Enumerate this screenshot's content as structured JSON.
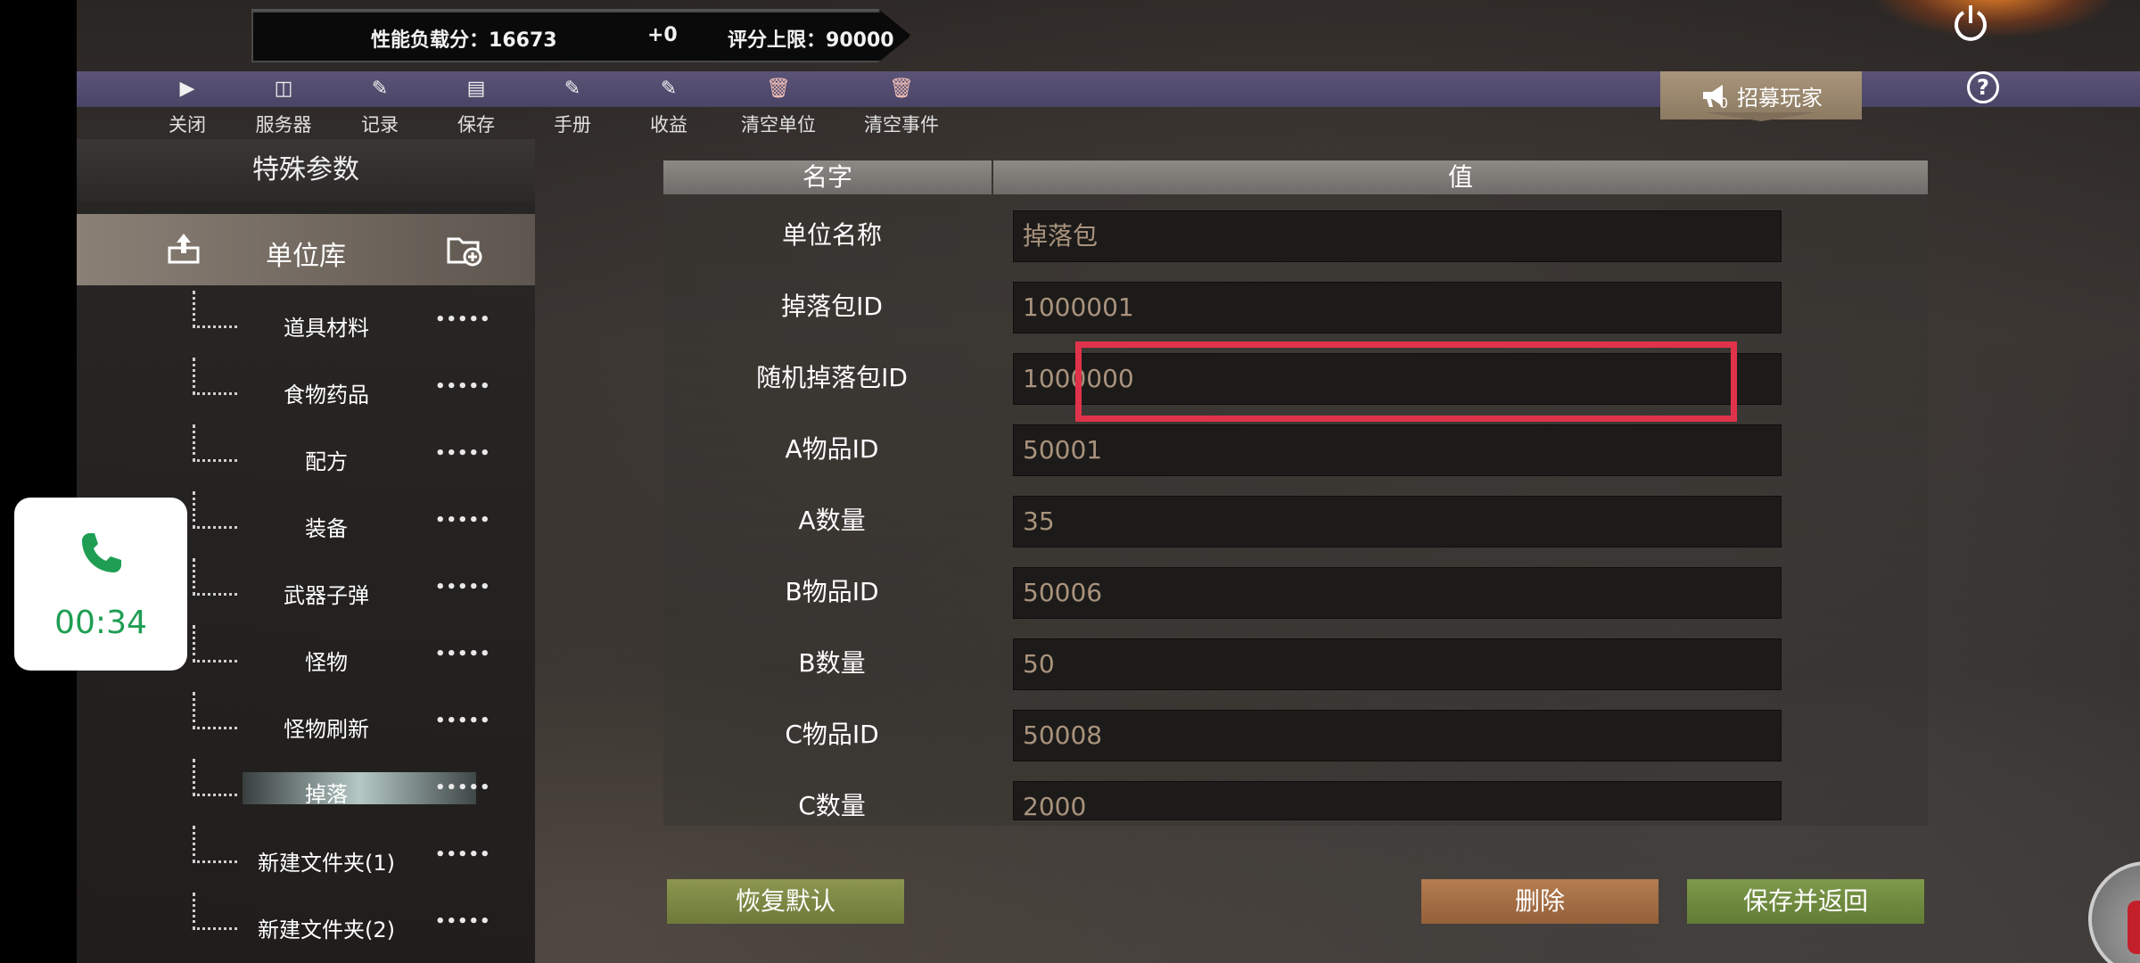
{
  "score": {
    "load_label": "性能负载分：",
    "load_value": "16673",
    "delta": "+0",
    "limit_label": "评分上限：",
    "limit_value": "90000"
  },
  "toolbar": [
    {
      "label": "关闭",
      "icon": "play-icon"
    },
    {
      "label": "服务器",
      "icon": "cube-icon"
    },
    {
      "label": "记录",
      "icon": "edit-icon"
    },
    {
      "label": "保存",
      "icon": "document-icon"
    },
    {
      "label": "手册",
      "icon": "edit-icon"
    },
    {
      "label": "收益",
      "icon": "edit-icon"
    },
    {
      "label": "清空单位",
      "icon": "trash-icon"
    },
    {
      "label": "清空事件",
      "icon": "trash-icon"
    }
  ],
  "recruit": {
    "label": "招募玩家",
    "count": "0"
  },
  "help": "?",
  "sidebar": {
    "title": "特殊参数",
    "library": "单位库",
    "items": [
      {
        "label": "道具材料"
      },
      {
        "label": "食物药品"
      },
      {
        "label": "配方"
      },
      {
        "label": "装备"
      },
      {
        "label": "武器子弹"
      },
      {
        "label": "怪物"
      },
      {
        "label": "怪物刷新"
      },
      {
        "label": "掉落",
        "active": true
      },
      {
        "label": "新建文件夹(1)"
      },
      {
        "label": "新建文件夹(2)"
      }
    ],
    "dots": "•••••"
  },
  "table": {
    "headers": {
      "name": "名字",
      "value": "值"
    },
    "rows": [
      {
        "name": "单位名称",
        "value": "掉落包"
      },
      {
        "name": "掉落包ID",
        "value": "1000001"
      },
      {
        "name": "随机掉落包ID",
        "value": "1000000"
      },
      {
        "name": "A物品ID",
        "value": "50001"
      },
      {
        "name": "A数量",
        "value": "35"
      },
      {
        "name": "B物品ID",
        "value": "50006"
      },
      {
        "name": "B数量",
        "value": "50"
      },
      {
        "name": "C物品ID",
        "value": "50008"
      },
      {
        "name": "C数量",
        "value": "2000"
      }
    ]
  },
  "buttons": {
    "reset": "恢复默认",
    "delete": "删除",
    "save": "保存并返回"
  },
  "call": {
    "time": "00:34"
  },
  "colors": {
    "highlight": "#e0334b",
    "call_green": "#1f9e53",
    "toolbar": "#5b5477"
  }
}
